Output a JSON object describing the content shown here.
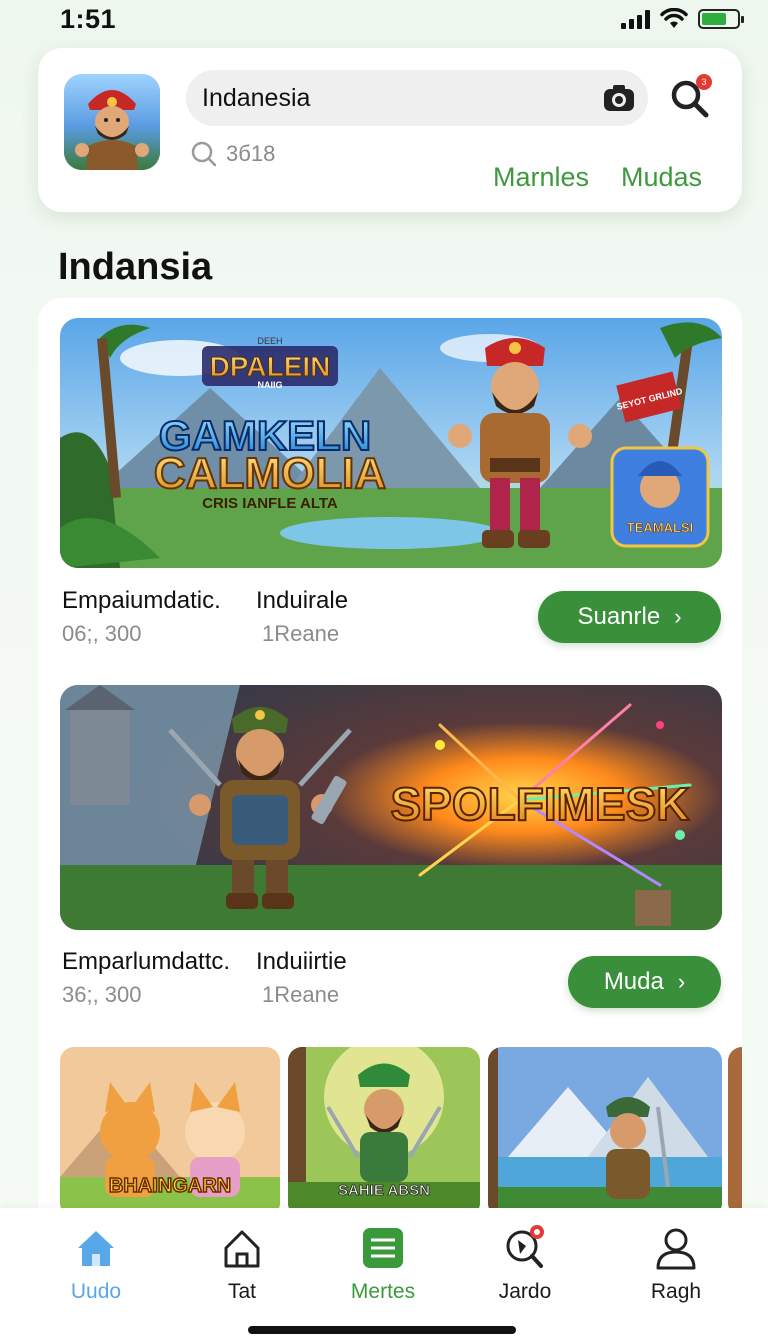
{
  "status": {
    "time": "1:51"
  },
  "header": {
    "search_value": "Indanesia",
    "sub_search": "3б18",
    "links": [
      "Marnles",
      "Mudas"
    ],
    "notification_count": "3"
  },
  "section": {
    "title": "Indansia"
  },
  "banners": [
    {
      "logo_small": "DPALEIN",
      "logo_small_sub": "NAIIG",
      "logo_top": "DEEH",
      "title_line1": "GAMKELN",
      "title_line2": "CALMOLIA",
      "title_line3": "CRIS IANFLE ALTA",
      "sign_text": "SEYOT GRLIND",
      "badge_text": "TEAMALSI"
    },
    {
      "title": "SPOLFIMESK"
    }
  ],
  "items": [
    {
      "title": "Empaiumdatic.",
      "tag": "Induirale",
      "sub": "06;, 300",
      "tag_sub": "1Reane",
      "cta": "Suanrle"
    },
    {
      "title": "Emparlumdattc.",
      "tag": "Induiirtie",
      "sub": "36;, 300",
      "tag_sub": "1Reane",
      "cta": "Muda"
    }
  ],
  "thumbs": [
    {
      "label": "BHAINGARN"
    },
    {
      "label": "SAHIE ABSN"
    },
    {
      "label": ""
    }
  ],
  "nav": [
    {
      "label": "Uudo",
      "icon": "home-icon"
    },
    {
      "label": "Tat",
      "icon": "house-outline-icon"
    },
    {
      "label": "Mertes",
      "icon": "list-icon"
    },
    {
      "label": "Jardo",
      "icon": "search-badge-icon"
    },
    {
      "label": "Ragh",
      "icon": "user-icon"
    }
  ],
  "colors": {
    "accent_green": "#3a8f3a",
    "nav_active_blue": "#58a7e8",
    "link_green": "#3c9a3c"
  }
}
